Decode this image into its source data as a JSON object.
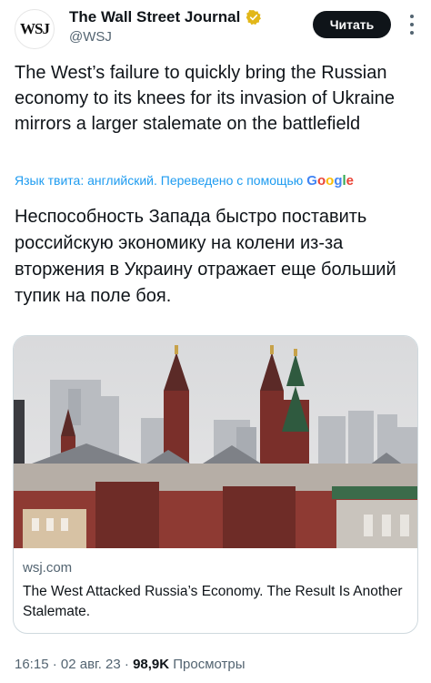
{
  "author": {
    "logo_text": "WSJ",
    "display_name": "The Wall Street Journal",
    "handle": "@WSJ",
    "verified_color": "#e2b719"
  },
  "actions": {
    "read_label": "Читать"
  },
  "tweet": {
    "text": "The West’s failure to quickly bring the Russian economy to its knees for its invasion of Ukraine mirrors a larger stalemate on the battlefield",
    "translation_note": "Язык твита: английский. Переведено с помощью",
    "translation_provider": "Google",
    "translated_text": "Неспособность Запада быстро поставить российскую экономику на колени из-за вторжения в Украину отражает еще больший тупик на поле боя."
  },
  "link_card": {
    "domain": "wsj.com",
    "title": "The West Attacked Russia’s Economy. The Result Is Another Stalemate."
  },
  "meta": {
    "time": "16:15",
    "sep1": "·",
    "date": "02 авг. 23",
    "sep2": "·",
    "views_count": "98,9K",
    "views_label": "Просмотры"
  },
  "colors": {
    "accent": "#1d9bf0",
    "text": "#0f1419",
    "muted": "#536471",
    "border": "#cfd9de"
  }
}
